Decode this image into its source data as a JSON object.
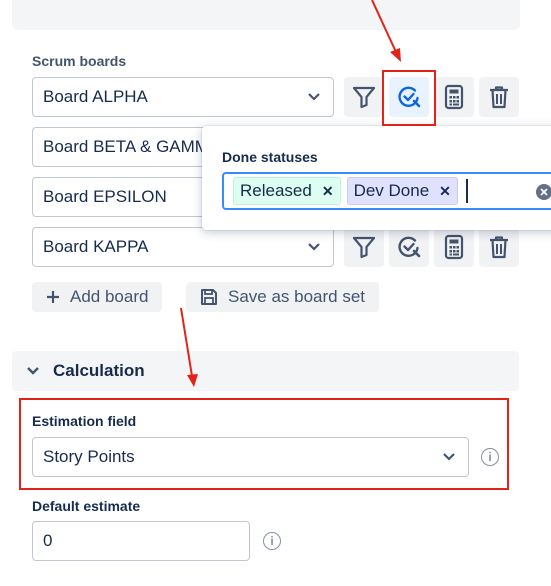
{
  "scrum_boards": {
    "label": "Scrum boards",
    "boards": [
      {
        "name": "Board ALPHA"
      },
      {
        "name": "Board BETA & GAMMA"
      },
      {
        "name": "Board EPSILON"
      },
      {
        "name": "Board KAPPA"
      }
    ],
    "add_board_label": "Add board",
    "save_set_label": "Save as board set"
  },
  "done_popup": {
    "title": "Done statuses",
    "tags": [
      {
        "label": "Released",
        "color": "#dcfff1"
      },
      {
        "label": "Dev Done",
        "color": "#dfe1ff"
      }
    ]
  },
  "calculation": {
    "title": "Calculation",
    "estimation_label": "Estimation field",
    "estimation_value": "Story Points",
    "default_label": "Default estimate",
    "default_value": "0"
  },
  "colors": {
    "accent": "#0c66e4",
    "highlight": "#e2231a"
  }
}
